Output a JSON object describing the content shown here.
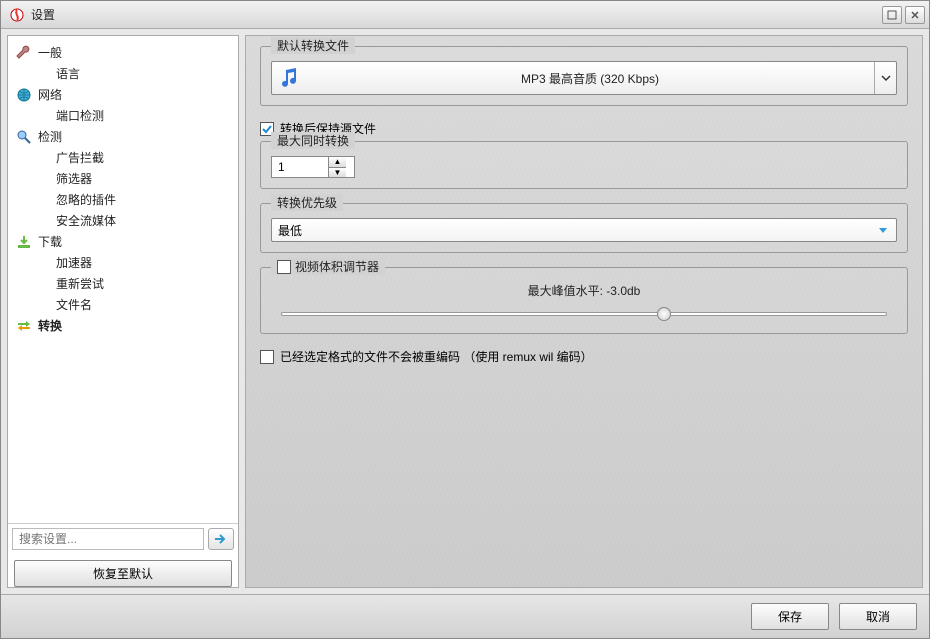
{
  "window": {
    "title": "设置"
  },
  "sidebar": {
    "cats": [
      {
        "label": "一般",
        "subs": [
          "语言"
        ]
      },
      {
        "label": "网络",
        "subs": [
          "端口检测"
        ]
      },
      {
        "label": "检测",
        "subs": [
          "广告拦截",
          "筛选器",
          "忽略的插件",
          "安全流媒体"
        ]
      },
      {
        "label": "下载",
        "subs": [
          "加速器",
          "重新尝试",
          "文件名"
        ]
      },
      {
        "label": "转换",
        "subs": []
      }
    ],
    "search_placeholder": "搜索设置...",
    "restore": "恢复至默认"
  },
  "main": {
    "g1": {
      "legend": "默认转换文件",
      "combo": "MP3 最高音质 (320 Kbps)"
    },
    "keep_source": "转换后保持源文件",
    "g2": {
      "legend": "最大同时转换",
      "value": "1"
    },
    "g3": {
      "legend": "转换优先级",
      "value": "最低"
    },
    "g4": {
      "legend": "视频体积调节器",
      "peak_label": "最大峰值水平: -3.0db"
    },
    "remux": "已经选定格式的文件不会被重编码 （使用 remux wil 编码）"
  },
  "footer": {
    "save": "保存",
    "cancel": "取消"
  }
}
